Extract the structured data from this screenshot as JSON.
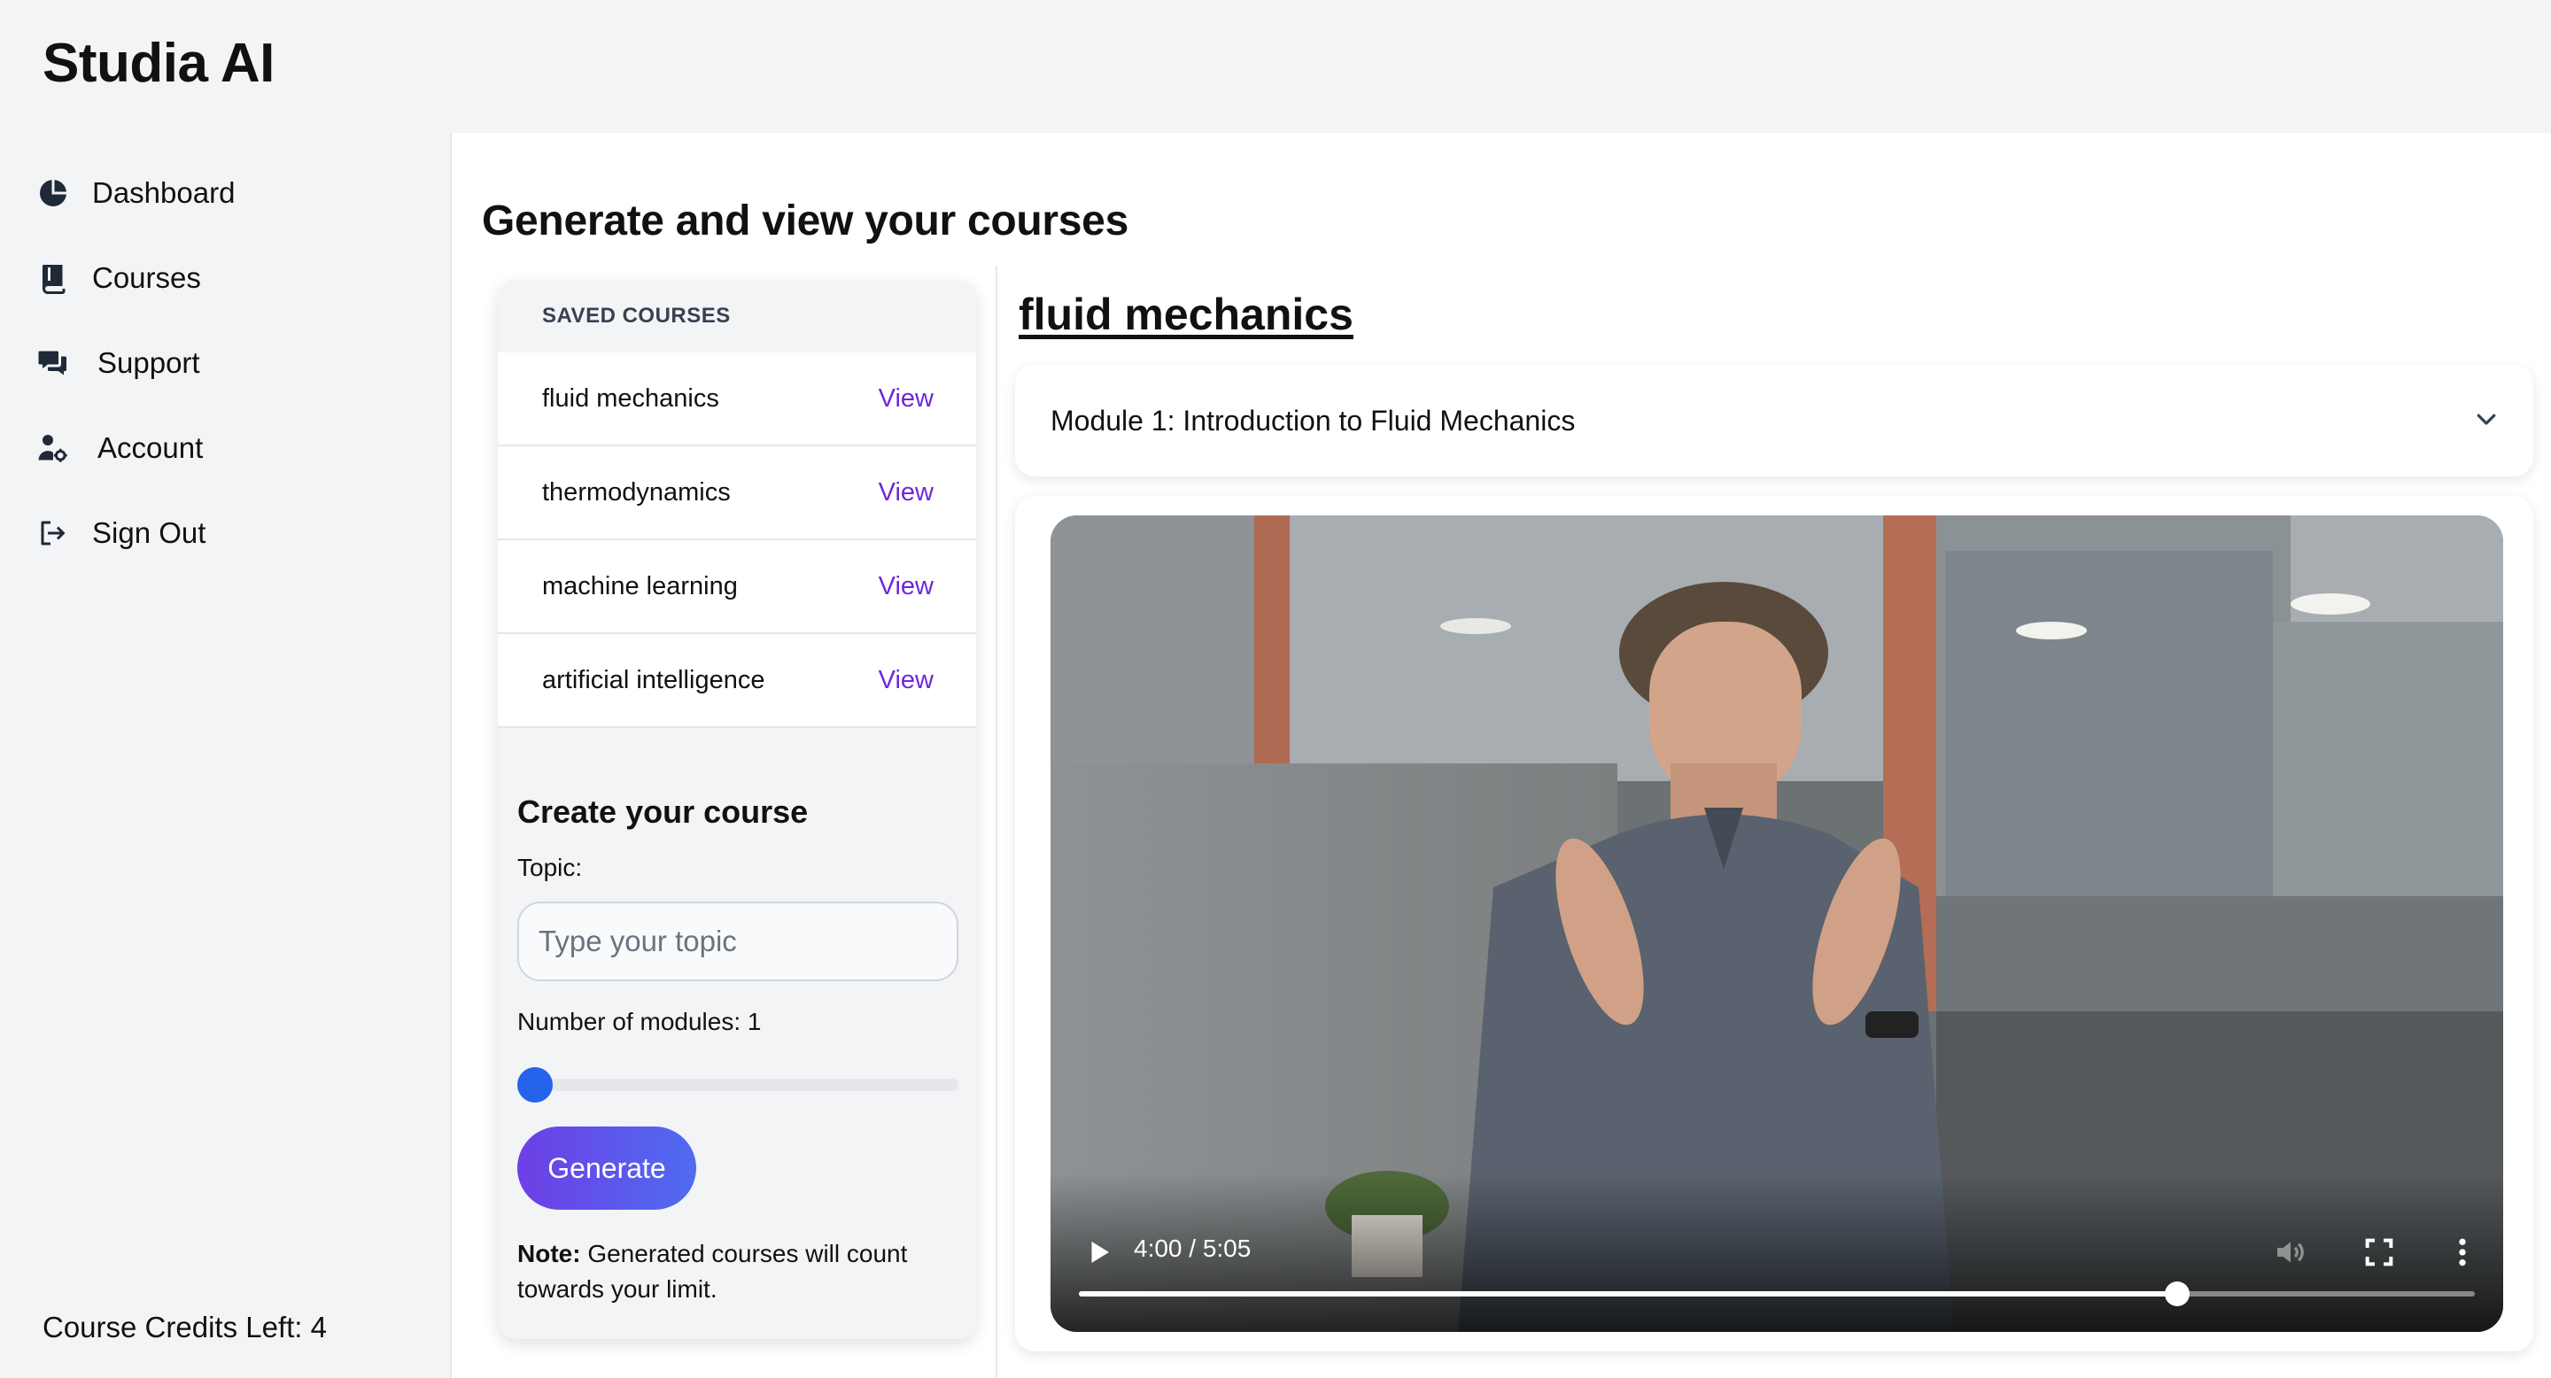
{
  "header": {
    "app_title": "Studia AI"
  },
  "sidebar": {
    "items": [
      {
        "label": "Dashboard",
        "icon": "pie-chart-icon"
      },
      {
        "label": "Courses",
        "icon": "book-icon"
      },
      {
        "label": "Support",
        "icon": "chat-bubbles-icon"
      },
      {
        "label": "Account",
        "icon": "user-gear-icon"
      },
      {
        "label": "Sign Out",
        "icon": "sign-out-icon"
      }
    ],
    "credits": "Course Credits Left: 4"
  },
  "main": {
    "page_title": "Generate and view your courses",
    "saved_courses": {
      "header": "SAVED COURSES",
      "view_label": "View",
      "items": [
        {
          "name": "fluid mechanics"
        },
        {
          "name": "thermodynamics"
        },
        {
          "name": "machine learning"
        },
        {
          "name": "artificial intelligence"
        }
      ]
    },
    "create": {
      "title": "Create your course",
      "topic_label": "Topic:",
      "topic_placeholder": "Type your topic",
      "topic_value": "",
      "modules_label": "Number of modules: 1",
      "modules_value": 1,
      "generate_label": "Generate",
      "note_bold": "Note:",
      "note_text": " Generated courses will count towards your limit."
    },
    "course": {
      "title": "fluid mechanics",
      "module_title": "Module 1: Introduction to Fluid Mechanics",
      "video": {
        "time": "4:00 / 5:05",
        "progress": 0.7868
      }
    }
  },
  "colors": {
    "accent_purple": "#6d28d9",
    "slider_blue": "#2563eb",
    "panel_gray": "#f3f4f6"
  }
}
